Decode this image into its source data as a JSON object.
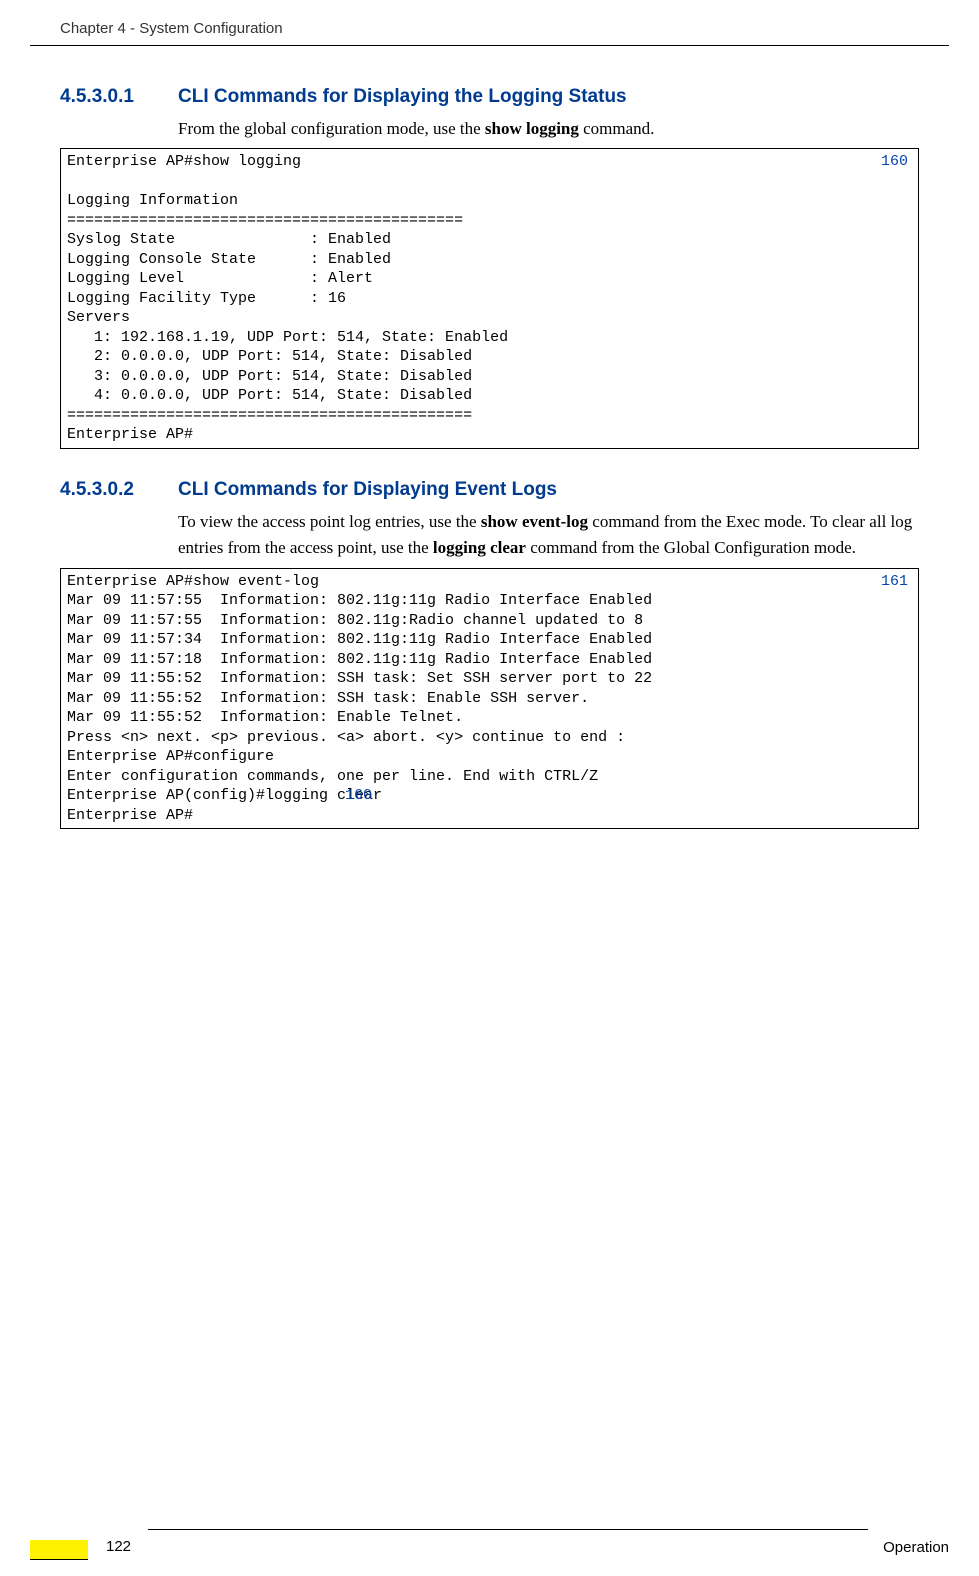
{
  "header": {
    "chapter": "Chapter 4 - System Configuration"
  },
  "section1": {
    "num": "4.5.3.0.1",
    "title": "CLI Commands for Displaying the Logging Status",
    "intro_pre": "From the global configuration mode, use the ",
    "intro_cmd": "show logging",
    "intro_post": " command.",
    "ref": "160",
    "code": "Enterprise AP#show logging\n\nLogging Information\n============================================\nSyslog State               : Enabled\nLogging Console State      : Enabled\nLogging Level              : Alert\nLogging Facility Type      : 16\nServers\n   1: 192.168.1.19, UDP Port: 514, State: Enabled\n   2: 0.0.0.0, UDP Port: 514, State: Disabled\n   3: 0.0.0.0, UDP Port: 514, State: Disabled\n   4: 0.0.0.0, UDP Port: 514, State: Disabled\n=============================================\nEnterprise AP#"
  },
  "section2": {
    "num": "4.5.3.0.2",
    "title": "CLI Commands for Displaying Event Logs",
    "intro_pre": "To view the access point log entries, use the ",
    "intro_cmd1": "show event-log",
    "intro_mid": " command from the Exec mode. To clear all log entries from the access point, use the ",
    "intro_cmd2": "logging clear",
    "intro_post": " command from the Global Configuration mode.",
    "ref1": "161",
    "ref2": "160",
    "code_pre": "Enterprise AP#show event-log\nMar 09 11:57:55  Information: 802.11g:11g Radio Interface Enabled\nMar 09 11:57:55  Information: 802.11g:Radio channel updated to 8\nMar 09 11:57:34  Information: 802.11g:11g Radio Interface Enabled\nMar 09 11:57:18  Information: 802.11g:11g Radio Interface Enabled\nMar 09 11:55:52  Information: SSH task: Set SSH server port to 22\nMar 09 11:55:52  Information: SSH task: Enable SSH server.\nMar 09 11:55:52  Information: Enable Telnet.\nPress <n> next. <p> previous. <a> abort. <y> continue to end :\nEnterprise AP#configure\nEnter configuration commands, one per line. End with CTRL/Z",
    "code_mid": "Enterprise AP(config)#logging clear",
    "code_post": "Enterprise AP#"
  },
  "footer": {
    "page": "122",
    "right": "Operation"
  }
}
